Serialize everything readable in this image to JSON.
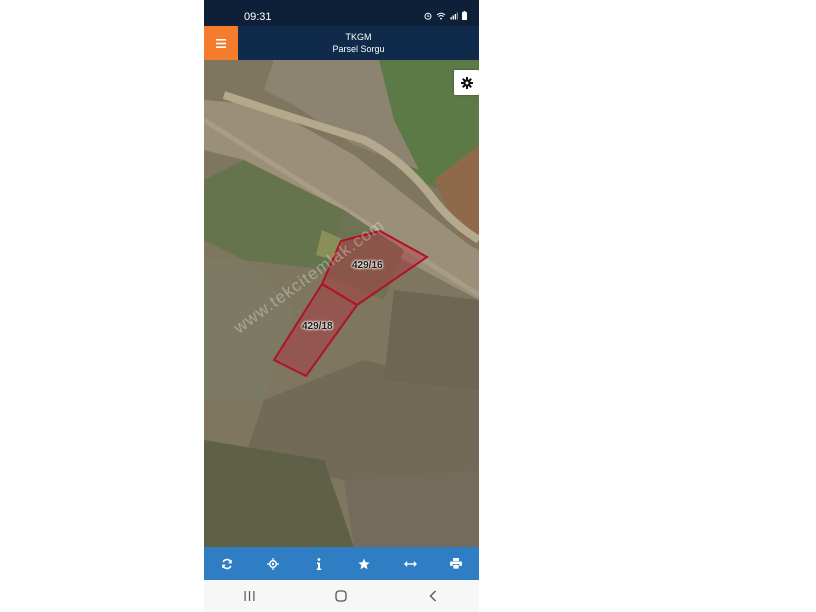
{
  "status": {
    "time": "09:31"
  },
  "appbar": {
    "title": "TKGM",
    "subtitle": "Parsel Sorgu"
  },
  "parcels": [
    {
      "label": "429/16"
    },
    {
      "label": "429/18"
    }
  ],
  "watermark": "www.tekcitemlak.com",
  "toolbar": {
    "items": [
      "refresh-icon",
      "locate-icon",
      "info-icon",
      "star-icon",
      "measure-icon",
      "print-icon"
    ]
  },
  "colors": {
    "appbar": "#0f2a4b",
    "menu_accent": "#f47c2c",
    "toolbar": "#2f7dc2",
    "parcel_outline": "#b0122a"
  }
}
